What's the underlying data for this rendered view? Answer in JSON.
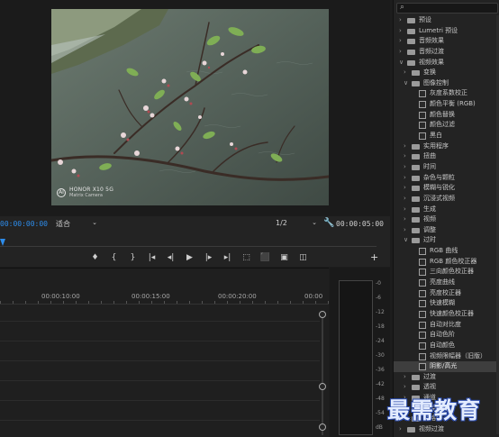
{
  "monitor": {
    "camera_watermark_line1": "HONOR X10 5G",
    "camera_watermark_line2": "Matrix Camera",
    "timecode_current": "00:00:00:00",
    "fit": "适合",
    "resolution": "1/2",
    "timecode_duration": "00:00:05:00",
    "transport_icons": [
      "marker-icon",
      "in-point-icon",
      "out-point-icon",
      "go-to-in-icon",
      "step-back-icon",
      "play-icon",
      "step-forward-icon",
      "go-to-out-icon",
      "insert-icon",
      "overwrite-icon",
      "export-frame-icon",
      "compare-icon"
    ],
    "add_button": "+"
  },
  "timeline": {
    "ruler": [
      "00:00:10:00",
      "00:00:15:00",
      "00:00:20:00",
      "00:00"
    ]
  },
  "meters": {
    "labels": [
      "-0",
      "-6",
      "-12",
      "-18",
      "-24",
      "-30",
      "-36",
      "-42",
      "-48",
      "-54",
      "dB"
    ]
  },
  "effects": {
    "search_placeholder": "",
    "items": [
      {
        "label": "预设",
        "level": 0,
        "state": "collapsed"
      },
      {
        "label": "Lumetri 预设",
        "level": 0,
        "state": "collapsed"
      },
      {
        "label": "音频效果",
        "level": 0,
        "state": "collapsed"
      },
      {
        "label": "音频过渡",
        "level": 0,
        "state": "collapsed"
      },
      {
        "label": "视频效果",
        "level": 0,
        "state": "expanded"
      },
      {
        "label": "变换",
        "level": 1,
        "state": "collapsed"
      },
      {
        "label": "图像控制",
        "level": 1,
        "state": "expanded"
      },
      {
        "label": "灰度系数校正",
        "level": 2,
        "state": "effect"
      },
      {
        "label": "颜色平衡 (RGB)",
        "level": 2,
        "state": "effect"
      },
      {
        "label": "颜色替换",
        "level": 2,
        "state": "effect"
      },
      {
        "label": "颜色过滤",
        "level": 2,
        "state": "effect"
      },
      {
        "label": "黑白",
        "level": 2,
        "state": "effect"
      },
      {
        "label": "实用程序",
        "level": 1,
        "state": "collapsed"
      },
      {
        "label": "扭曲",
        "level": 1,
        "state": "collapsed"
      },
      {
        "label": "时间",
        "level": 1,
        "state": "collapsed"
      },
      {
        "label": "杂色与颗粒",
        "level": 1,
        "state": "collapsed"
      },
      {
        "label": "模糊与锐化",
        "level": 1,
        "state": "collapsed"
      },
      {
        "label": "沉浸式视频",
        "level": 1,
        "state": "collapsed"
      },
      {
        "label": "生成",
        "level": 1,
        "state": "collapsed"
      },
      {
        "label": "视频",
        "level": 1,
        "state": "collapsed"
      },
      {
        "label": "调整",
        "level": 1,
        "state": "collapsed"
      },
      {
        "label": "过时",
        "level": 1,
        "state": "expanded"
      },
      {
        "label": "RGB 曲线",
        "level": 2,
        "state": "effect"
      },
      {
        "label": "RGB 颜色校正器",
        "level": 2,
        "state": "effect"
      },
      {
        "label": "三向颜色校正器",
        "level": 2,
        "state": "effect"
      },
      {
        "label": "亮度曲线",
        "level": 2,
        "state": "effect"
      },
      {
        "label": "亮度校正器",
        "level": 2,
        "state": "effect"
      },
      {
        "label": "快速模糊",
        "level": 2,
        "state": "effect"
      },
      {
        "label": "快速颜色校正器",
        "level": 2,
        "state": "effect"
      },
      {
        "label": "自动对比度",
        "level": 2,
        "state": "effect"
      },
      {
        "label": "自动色阶",
        "level": 2,
        "state": "effect"
      },
      {
        "label": "自动颜色",
        "level": 2,
        "state": "effect"
      },
      {
        "label": "视频限幅器（旧版）",
        "level": 2,
        "state": "effect"
      },
      {
        "label": "阴影/高光",
        "level": 2,
        "state": "effect",
        "selected": true
      },
      {
        "label": "过渡",
        "level": 1,
        "state": "collapsed"
      },
      {
        "label": "透视",
        "level": 1,
        "state": "collapsed"
      },
      {
        "label": "通道",
        "level": 1,
        "state": "collapsed"
      },
      {
        "label": "键控",
        "level": 1,
        "state": "collapsed"
      },
      {
        "label": "风格化",
        "level": 1,
        "state": "collapsed"
      },
      {
        "label": "视频过渡",
        "level": 0,
        "state": "collapsed"
      }
    ]
  },
  "watermark": "最需教育"
}
